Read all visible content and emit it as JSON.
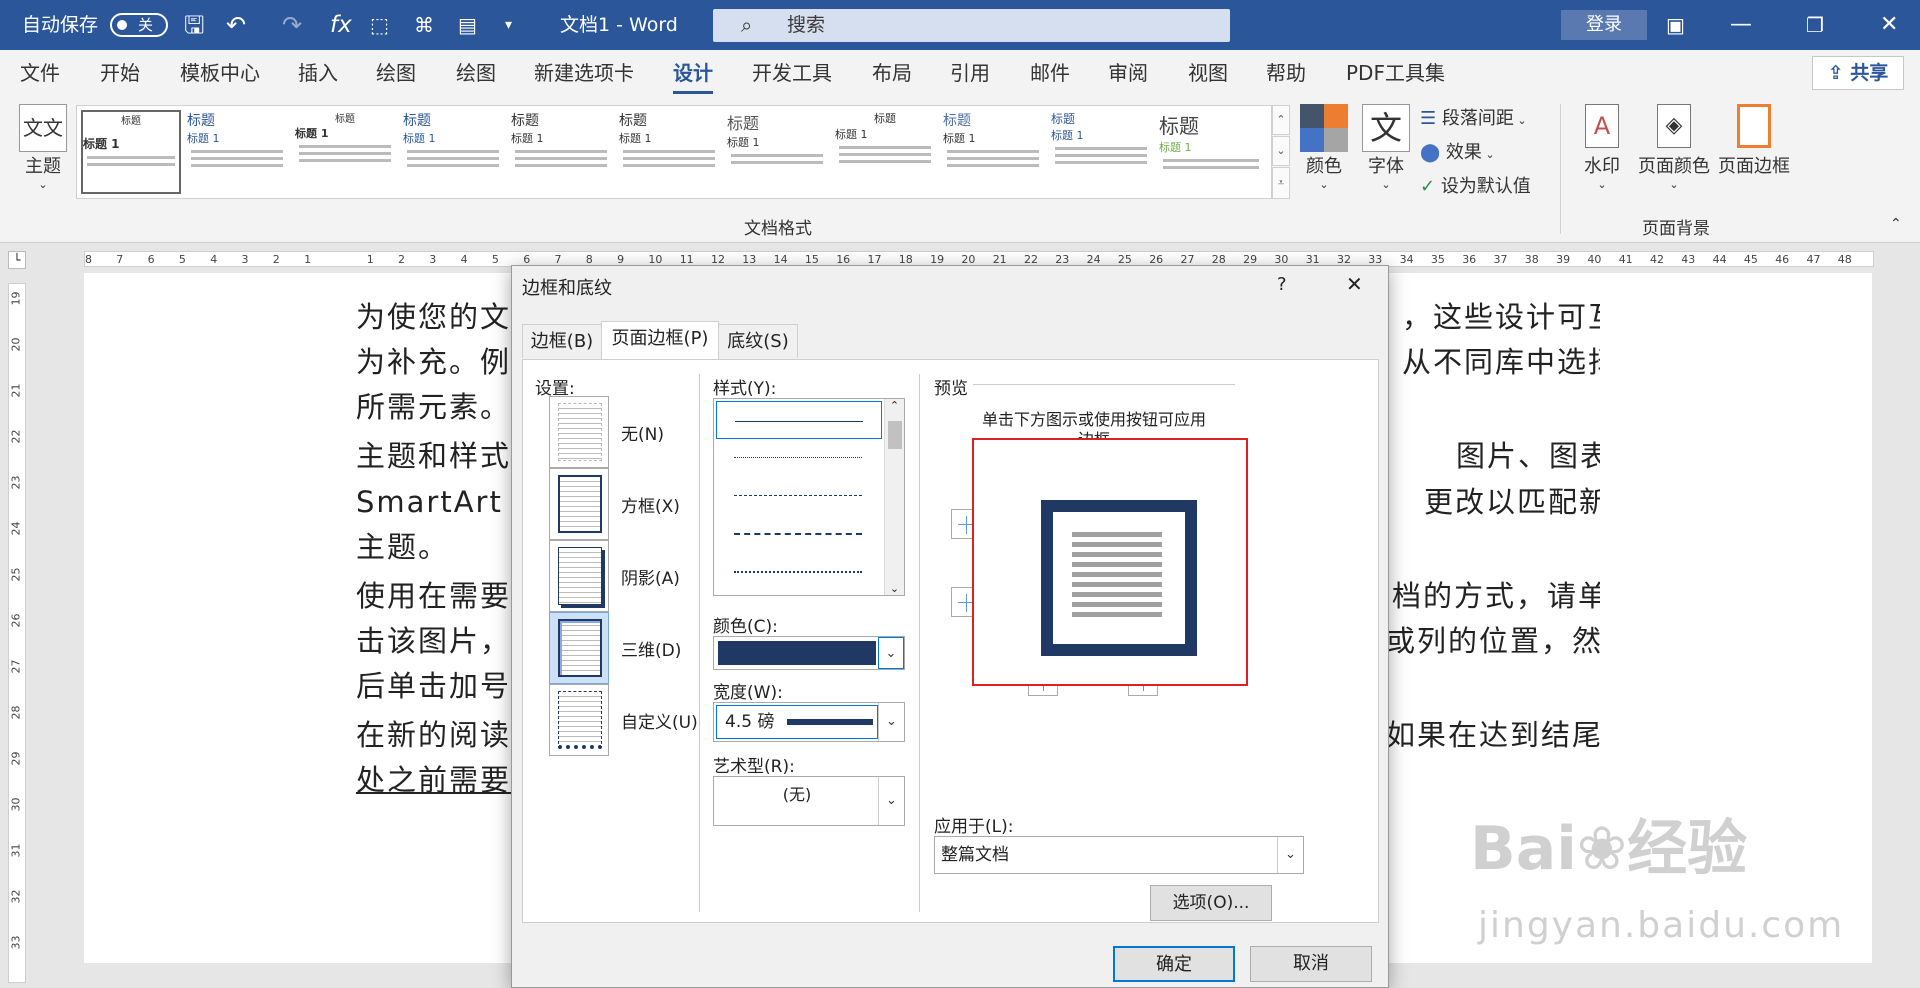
{
  "titlebar": {
    "autosave_label": "自动保存",
    "autosave_state": "关",
    "doc_title": "文档1 - Word",
    "search_placeholder": "搜索",
    "login": "登录"
  },
  "menu": {
    "tabs": [
      "文件",
      "开始",
      "模板中心",
      "插入",
      "绘图",
      "绘图",
      "新建选项卡",
      "设计",
      "开发工具",
      "布局",
      "引用",
      "邮件",
      "审阅",
      "视图",
      "帮助",
      "PDF工具集"
    ],
    "active": "设计",
    "share": "共享"
  },
  "ribbon": {
    "theme_label": "主题",
    "gallery_group_label": "文档格式",
    "gallery_items": [
      {
        "title": "标题",
        "heading": "标题 1"
      },
      {
        "title": "标题",
        "heading": "标题 1"
      },
      {
        "title": "标题",
        "heading": "标题 1"
      },
      {
        "title": "标题",
        "heading": "标题 1"
      },
      {
        "title": "标题",
        "heading": "标题 1"
      },
      {
        "title": "标题",
        "heading": "标题 1"
      },
      {
        "title": "标题",
        "heading": "标题 1"
      },
      {
        "title": "标题",
        "heading": "标题 1"
      },
      {
        "title": "标题",
        "heading": "标题 1"
      },
      {
        "title": "标题",
        "heading": "标题 1"
      },
      {
        "title": "标题",
        "heading": "标题 1"
      },
      {
        "title": "标题",
        "heading": "标题 1"
      }
    ],
    "colors_label": "颜色",
    "fonts_label": "字体",
    "paragraph_spacing": "段落间距",
    "effects": "效果",
    "set_default": "设为默认值",
    "watermark": "水印",
    "page_color": "页面颜色",
    "page_borders": "页面边框",
    "page_background_group": "页面背景",
    "theme_icon_text": "文文"
  },
  "ruler": {
    "h_numbers": [
      "8",
      "7",
      "6",
      "5",
      "4",
      "3",
      "2",
      "1",
      "",
      "1",
      "2",
      "3",
      "4",
      "5",
      "6",
      "7",
      "8",
      "9",
      "10",
      "11",
      "12",
      "13",
      "14",
      "15",
      "16",
      "17",
      "18",
      "19",
      "20",
      "21",
      "22",
      "23",
      "24",
      "25",
      "26",
      "27",
      "28",
      "29",
      "30",
      "31",
      "32",
      "33",
      "34",
      "35",
      "36",
      "37",
      "38",
      "39",
      "40",
      "41",
      "42",
      "43",
      "44",
      "45",
      "46",
      "47",
      "48"
    ],
    "v_numbers": [
      "19",
      "20",
      "21",
      "22",
      "23",
      "24",
      "25",
      "26",
      "27",
      "28",
      "29",
      "30",
      "31",
      "32",
      "33"
    ]
  },
  "document": {
    "lines": [
      [
        "为使您的文",
        "，这些设计可互"
      ],
      [
        "为补充。例",
        "从不同库中选择"
      ],
      [
        "所需元素。",
        ""
      ],
      [
        "主题和样式",
        "图片、图表或"
      ],
      [
        "SmartArt 图",
        "更改以匹配新的"
      ],
      [
        "主题。",
        ""
      ],
      [
        "使用在需要",
        "档的方式，请单"
      ],
      [
        "击该图片，",
        "或列的位置，然"
      ],
      [
        "后单击加号",
        ""
      ],
      [
        "在新的阅读",
        "如果在达到结尾"
      ],
      [
        "处之前需要",
        ""
      ]
    ]
  },
  "dialog": {
    "title": "边框和底纹",
    "help": "?",
    "close": "✕",
    "tabs": [
      "边框(B)",
      "页面边框(P)",
      "底纹(S)"
    ],
    "active_tab": "页面边框(P)",
    "setting_label": "设置:",
    "settings": [
      "无(N)",
      "方框(X)",
      "阴影(A)",
      "三维(D)",
      "自定义(U)"
    ],
    "selected_setting": "三维(D)",
    "style_label": "样式(Y):",
    "color_label": "颜色(C):",
    "color_value": "#1f3864",
    "width_label": "宽度(W):",
    "width_value": "4.5 磅",
    "art_label": "艺术型(R):",
    "art_value": "(无)",
    "preview_label": "预览",
    "preview_hint_1": "单击下方图示或使用按钮可应用",
    "preview_hint_2": "边框",
    "apply_label": "应用于(L):",
    "apply_value": "整篇文档",
    "options_button": "选项(O)...",
    "ok": "确定",
    "cancel": "取消"
  },
  "watermark": {
    "line1": "Bai",
    "line1b": "经验",
    "line2": "jingyan.baidu.com"
  },
  "colors": {
    "titlebar": "#2b579a",
    "accent": "#2b579a",
    "border_navy": "#1f3864",
    "highlight_red": "#e02020"
  }
}
